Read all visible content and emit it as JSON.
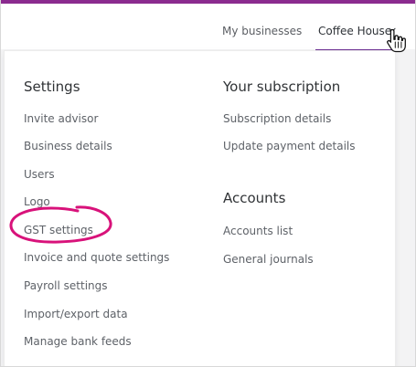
{
  "nav": {
    "my_businesses": "My businesses",
    "current_business": "Coffee House"
  },
  "settings": {
    "title": "Settings",
    "items": [
      "Invite advisor",
      "Business details",
      "Users",
      "Logo",
      "GST settings",
      "Invoice and quote settings",
      "Payroll settings",
      "Import/export data",
      "Manage bank feeds"
    ]
  },
  "subscription": {
    "title": "Your subscription",
    "items": [
      "Subscription details",
      "Update payment details"
    ]
  },
  "accounts": {
    "title": "Accounts",
    "items": [
      "Accounts list",
      "General journals"
    ]
  },
  "colors": {
    "top_accent": "#8b2b8f",
    "active_underline": "#6a2b91",
    "highlight": "#d8127a"
  },
  "icons": {
    "chevron": "chevron-down-icon",
    "cursor": "hand-pointer-icon"
  }
}
